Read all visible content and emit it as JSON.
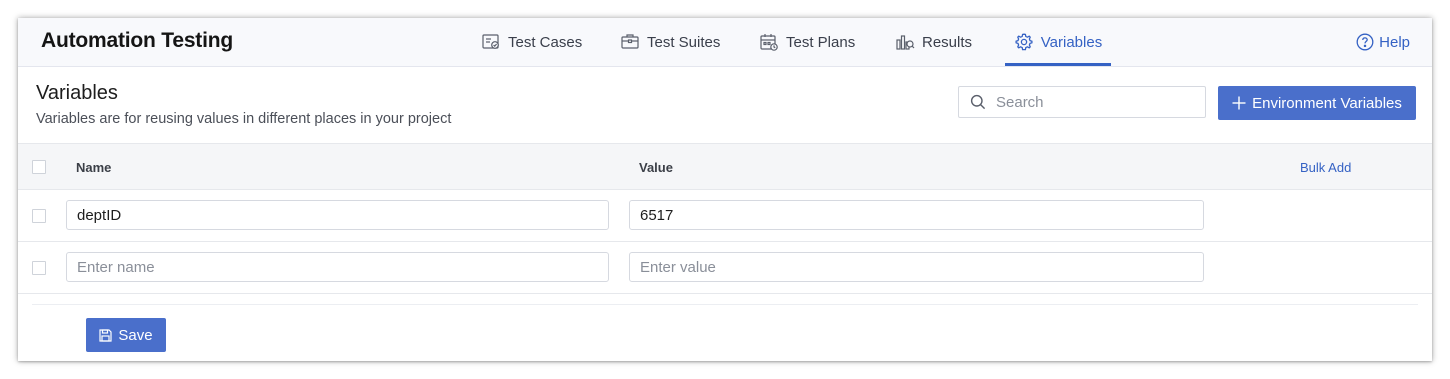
{
  "app": {
    "title": "Automation Testing"
  },
  "tabs": [
    {
      "label": "Test Cases",
      "icon": "test-cases-icon"
    },
    {
      "label": "Test Suites",
      "icon": "test-suites-icon"
    },
    {
      "label": "Test Plans",
      "icon": "test-plans-icon"
    },
    {
      "label": "Results",
      "icon": "results-icon"
    },
    {
      "label": "Variables",
      "icon": "gear-icon",
      "active": true
    }
  ],
  "help": {
    "label": "Help",
    "icon": "help-icon"
  },
  "page": {
    "title": "Variables",
    "subtitle": "Variables are for reusing values in different places in your project"
  },
  "search": {
    "placeholder": "Search",
    "icon": "search-icon"
  },
  "env_button": {
    "label": "Environment Variables",
    "icon": "plus-icon"
  },
  "table": {
    "columns": {
      "name": "Name",
      "value": "Value",
      "bulk_add": "Bulk Add"
    },
    "rows": [
      {
        "name": "deptID",
        "value": "6517"
      }
    ],
    "new_row": {
      "name_placeholder": "Enter name",
      "value_placeholder": "Enter value"
    }
  },
  "save_button": {
    "label": "Save",
    "icon": "save-icon"
  },
  "colors": {
    "accent": "#3562c4",
    "button": "#4a6fcb",
    "header_bg": "#f8f9fc"
  }
}
